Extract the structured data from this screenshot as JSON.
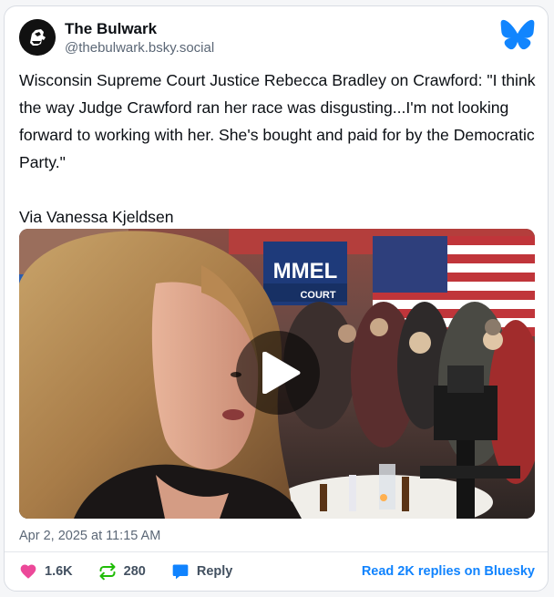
{
  "author": {
    "display_name": "The Bulwark",
    "handle": "@thebulwark.bsky.social",
    "avatar_icon": "bulwark-logo-icon"
  },
  "platform_icon": "bluesky-butterfly-icon",
  "post": {
    "paragraphs": [
      "Wisconsin Supreme Court Justice Rebecca Bradley on Crawford: \"I think the way Judge Crawford ran her race was disgusting...I'm not looking forward to working with her. She's bought and paid for by the Democratic Party.\"",
      "Via Vanessa Kjeldsen"
    ],
    "media": {
      "type": "video",
      "play_icon": "play-icon",
      "banner_text_1": "MMEL",
      "banner_text_2": "COURT"
    },
    "timestamp": "Apr 2, 2025 at 11:15 AM"
  },
  "actions": {
    "likes": "1.6K",
    "reposts": "280",
    "reply_label": "Reply",
    "read_replies": "Read 2K replies on Bluesky"
  },
  "colors": {
    "like": "#ec4899",
    "repost": "#20bc07",
    "reply": "#1083fe",
    "link": "#1083fe",
    "bluesky": "#1185fe"
  }
}
